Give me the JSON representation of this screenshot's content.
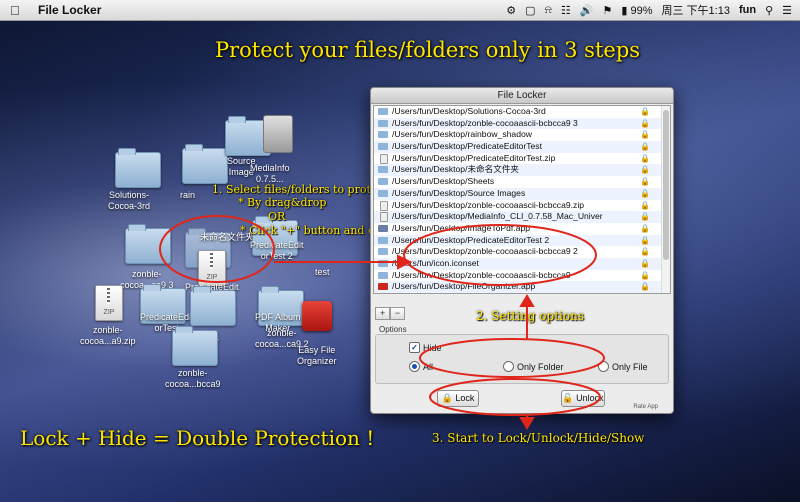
{
  "menubar": {
    "apple_icon": "apple-icon",
    "app_name": "File Locker",
    "battery": "99%",
    "clock": "周三 下午1:13",
    "user": "fun"
  },
  "headline": "Protect your files/folders only in 3 steps",
  "footer_text": "Lock + Hide = Double Protection !",
  "steps": {
    "step1_title": "1. Select files/folders to protect:",
    "step1_a": "* By drag&drop",
    "step1_or": "OR",
    "step1_b": "* Click \"+\" button and choose files/folders",
    "step2": "2. Setting options",
    "step3": "3. Start to Lock/Unlock/Hide/Show"
  },
  "desktop_labels": {
    "solutions": "Solutions-\nCocoa-3rd",
    "rain": "rain",
    "source": "Source\nImage",
    "mediainfo": "MediaInfo\n0.7.5...",
    "unnamed": "未命名文件夹",
    "zonble1": "zonble-\ncocoa...ca9 3",
    "predicate": "PredicateEdit",
    "predicate2": "PredicateEdit\norTest",
    "predicate3": "PredicateEdit\norTest 2",
    "zipfile1": "zonble-\ncocoa...a9.zip",
    "zonble2": "zonble-\ncocoa...bcca9",
    "zonble3": "zonble-\ncocoa...ca9 2",
    "pdf": "PDF Album\nMaker",
    "test": "test",
    "sets": "ets",
    "easy": "Easy File\nOrganizer"
  },
  "window": {
    "title": "File Locker",
    "files": [
      {
        "path": "/Users/fun/Desktop/Solutions-Cocoa-3rd",
        "icon": "folder-icon"
      },
      {
        "path": "/Users/fun/Desktop/zonble-cocoaascii-bcbcca9 3",
        "icon": "folder-icon"
      },
      {
        "path": "/Users/fun/Desktop/rainbow_shadow",
        "icon": "folder-icon"
      },
      {
        "path": "/Users/fun/Desktop/PredicateEditorTest",
        "icon": "folder-icon"
      },
      {
        "path": "/Users/fun/Desktop/PredicateEditorTest.zip",
        "icon": "zip-icon"
      },
      {
        "path": "/Users/fun/Desktop/未命名文件夹",
        "icon": "folder-icon"
      },
      {
        "path": "/Users/fun/Desktop/Sheets",
        "icon": "folder-icon"
      },
      {
        "path": "/Users/fun/Desktop/Source Images",
        "icon": "folder-icon"
      },
      {
        "path": "/Users/fun/Desktop/zonble-cocoaascii-bcbcca9.zip",
        "icon": "zip-icon"
      },
      {
        "path": "/Users/fun/Desktop/MediaInfo_CLI_0.7.58_Mac_Univer",
        "icon": "zip-icon"
      },
      {
        "path": "/Users/fun/Desktop/ImageToPdf.app",
        "icon": "app-icon"
      },
      {
        "path": "/Users/fun/Desktop/PredicateEditorTest 2",
        "icon": "folder-icon"
      },
      {
        "path": "/Users/fun/Desktop/zonble-cocoaascii-bcbcca9 2",
        "icon": "folder-icon"
      },
      {
        "path": "/Users/fun/icon.iconset",
        "icon": "folder-icon"
      },
      {
        "path": "/Users/fun/Desktop/zonble-cocoaascii-bcbcca9",
        "icon": "folder-icon"
      },
      {
        "path": "/Users/fun/Desktop/FileOrganizer.app",
        "icon": "app-icon"
      }
    ],
    "add_label": "+",
    "remove_label": "−",
    "options_title": "Options",
    "hide_label": "Hide",
    "hide_checked": true,
    "radio_all": "All",
    "radio_folder": "Only Folder",
    "radio_file": "Only File",
    "selected_radio": "All",
    "lock_label": "Lock",
    "unlock_label": "Unlock",
    "rate_label": "Rate App"
  },
  "colors": {
    "highlight_yellow": "#ffe600",
    "annotation_red": "#e0261b",
    "list_alt_row": "#edf3fe"
  }
}
